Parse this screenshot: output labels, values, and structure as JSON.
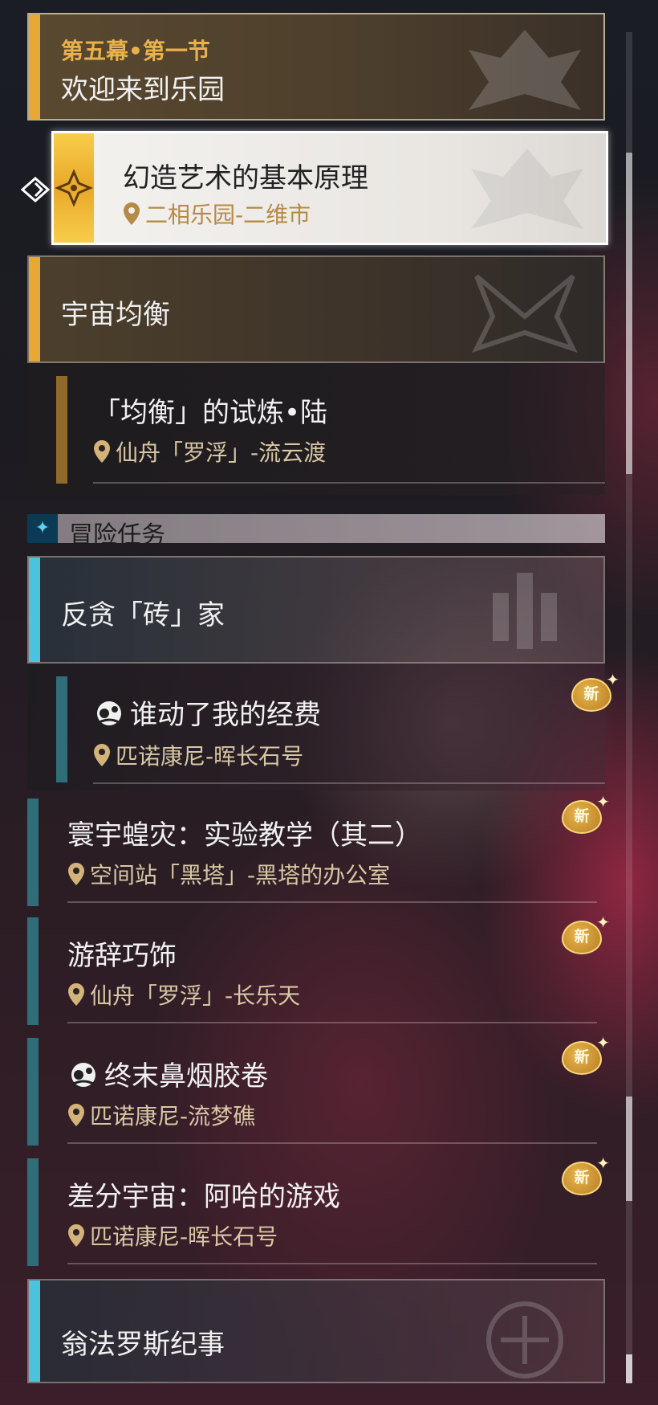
{
  "chapter": {
    "subtitle": "第五幕•第一节",
    "title": "欢迎来到乐园"
  },
  "selected_quest": {
    "title": "幻造艺术的基本原理",
    "location": "二相乐园-二维市"
  },
  "trailblaze_section": {
    "title": "宇宙均衡",
    "quests": [
      {
        "title": "「均衡」的试炼•陆",
        "location": "仙舟「罗浮」-流云渡"
      }
    ]
  },
  "adventure_header": {
    "label": "冒险任务"
  },
  "adventure_section": {
    "title": "反贪「砖」家",
    "quests": [
      {
        "title": "谁动了我的经费",
        "location": "匹诺康尼-晖长石号",
        "badge": "新"
      }
    ]
  },
  "adventure_list": [
    {
      "title": "寰宇蝗灾：实验教学（其二）",
      "location": "空间站「黑塔」-黑塔的办公室",
      "badge": "新"
    },
    {
      "title": "游辞巧饰",
      "location": "仙舟「罗浮」-长乐天",
      "badge": "新"
    },
    {
      "title": "终末鼻烟胶卷",
      "location": "匹诺康尼-流梦礁",
      "badge": "新"
    },
    {
      "title": "差分宇宙：阿哈的游戏",
      "location": "匹诺康尼-晖长石号",
      "badge": "新"
    }
  ],
  "bottom_section": {
    "title": "翁法罗斯纪事"
  },
  "colors": {
    "gold_accent": "#e8a835",
    "cyan_accent": "#4bc3de",
    "teal_accent": "#2f6e78",
    "location_text": "#d8c7a4"
  },
  "icons": [
    "pointer-icon",
    "compass-star-icon",
    "location-pin-icon",
    "aha-mask-icon",
    "new-badge-icon",
    "adventure-star-icon"
  ]
}
